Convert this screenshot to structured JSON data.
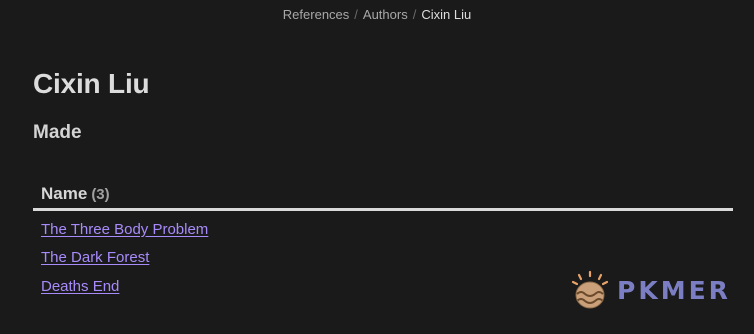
{
  "breadcrumb": {
    "items": [
      "References",
      "Authors",
      "Cixin Liu"
    ],
    "separator": "/"
  },
  "page": {
    "title": "Cixin Liu",
    "section_heading": "Made"
  },
  "table": {
    "column_name": "Name",
    "count": "(3)",
    "rows": [
      "The Three Body Problem",
      "The Dark Forest",
      "Deaths End"
    ]
  },
  "watermark": {
    "brand_text": "PKMER",
    "logo_icon": "egg-logo-icon"
  },
  "colors": {
    "background": "#1a1a1a",
    "link": "#a88bfa",
    "brand": "#7b7ec2"
  }
}
